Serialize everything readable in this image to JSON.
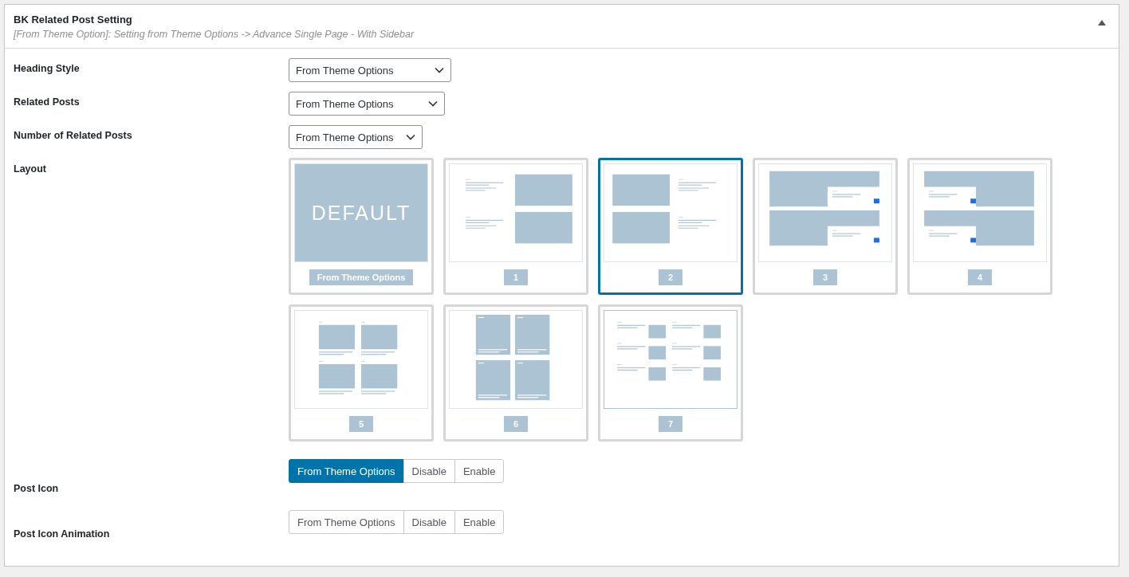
{
  "panel": {
    "title": "BK Related Post Setting",
    "subtitle": "[From Theme Option]: Setting from Theme Options -> Advance Single Page - With Sidebar"
  },
  "fields": [
    {
      "kind": "select",
      "label": "Heading Style",
      "value": "From Theme Options"
    },
    {
      "kind": "select",
      "label": "Related Posts",
      "value": "From Theme Options"
    },
    {
      "kind": "select",
      "label": "Number of Related Posts",
      "value": "From Theme Options"
    },
    {
      "kind": "layout",
      "label": "Layout",
      "options": [
        {
          "kind": "default",
          "preview_text": "DEFAULT",
          "caption": "From Theme Options",
          "selected": false
        },
        {
          "kind": "list-right",
          "caption": "1",
          "selected": false
        },
        {
          "kind": "list-left",
          "caption": "2",
          "selected": true
        },
        {
          "kind": "overlay-left",
          "caption": "3",
          "selected": false
        },
        {
          "kind": "overlay-right",
          "caption": "4",
          "selected": false
        },
        {
          "kind": "grid",
          "caption": "5",
          "selected": false
        },
        {
          "kind": "tall-grid",
          "caption": "6",
          "selected": false
        },
        {
          "kind": "compact",
          "caption": "7",
          "selected": false
        }
      ]
    },
    {
      "kind": "buttons",
      "label": "Post Icon",
      "options": [
        {
          "label": "From Theme Options",
          "selected": true
        },
        {
          "label": "Disable",
          "selected": false
        },
        {
          "label": "Enable",
          "selected": false
        }
      ]
    },
    {
      "kind": "buttons",
      "label": "Post Icon Animation",
      "options": [
        {
          "label": "From Theme Options",
          "selected": false
        },
        {
          "label": "Disable",
          "selected": false
        },
        {
          "label": "Enable",
          "selected": false
        }
      ]
    }
  ]
}
